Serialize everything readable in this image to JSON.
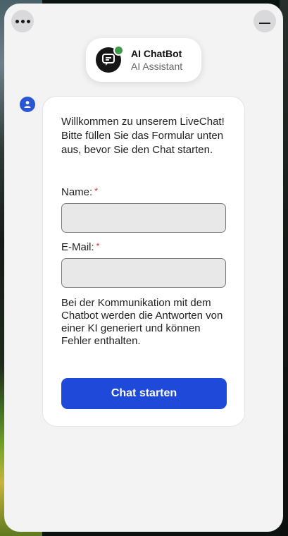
{
  "header": {
    "menu_icon": "more-dots-icon",
    "minimize_icon": "minimize-icon"
  },
  "bot": {
    "name": "AI ChatBot",
    "subtitle": "AI Assistant",
    "status_color": "#3c9a4a"
  },
  "form": {
    "welcome_text": "Willkommen zu unserem LiveChat! Bitte füllen Sie das Formular unten aus, bevor Sie den Chat starten.",
    "name_label": "Name:",
    "email_label": "E-Mail:",
    "required_marker": "*",
    "name_value": "",
    "email_value": "",
    "disclaimer": "Bei der Kommunikation mit dem Chatbot werden die Antworten von einer KI generiert und können Fehler enthalten.",
    "submit_label": "Chat starten"
  },
  "colors": {
    "accent": "#1f4ad9",
    "required": "#d02a2a"
  }
}
